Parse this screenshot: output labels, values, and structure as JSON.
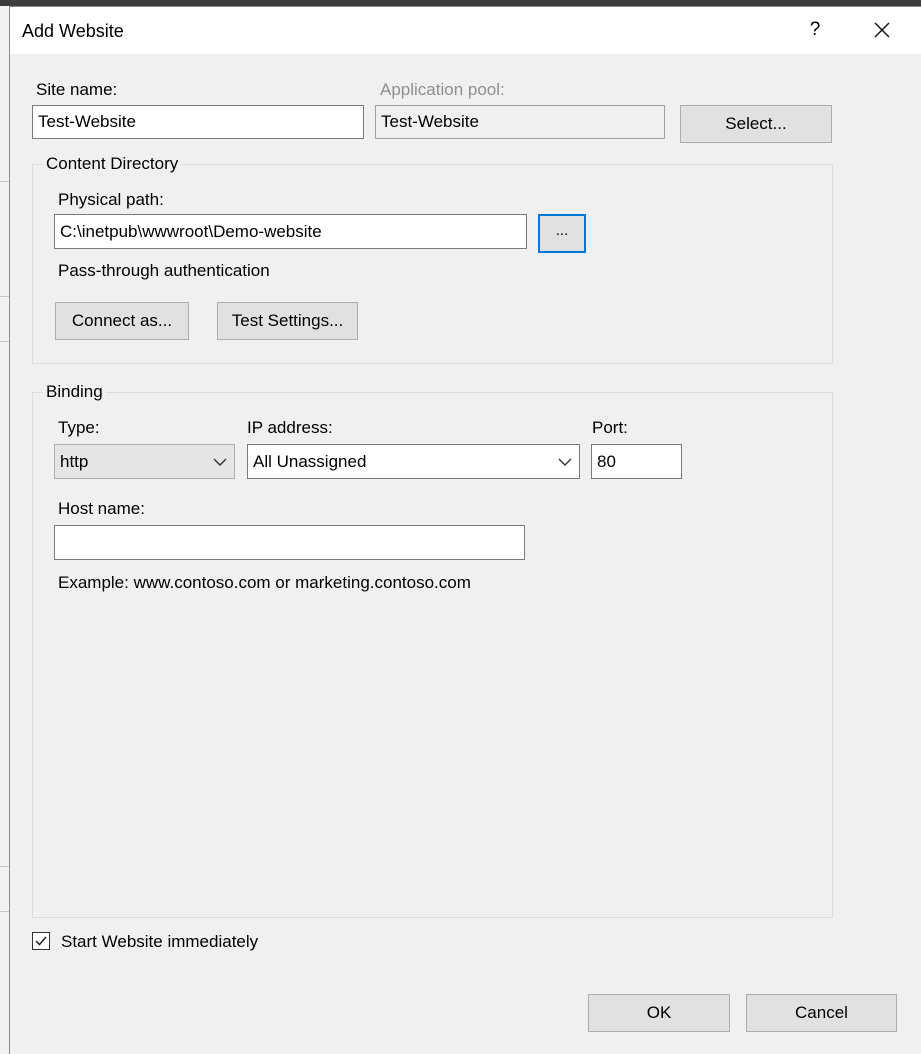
{
  "dialog": {
    "title": "Add Website",
    "help_label": "?"
  },
  "site": {
    "site_name_label": "Site name:",
    "site_name_value": "Test-Website",
    "app_pool_label": "Application pool:",
    "app_pool_value": "Test-Website",
    "select_button": "Select..."
  },
  "content_directory": {
    "legend": "Content Directory",
    "physical_path_label": "Physical path:",
    "physical_path_value": "C:\\inetpub\\wwwroot\\Demo-website",
    "browse_button": "...",
    "passthrough_label": "Pass-through authentication",
    "connect_as_button": "Connect as...",
    "test_settings_button": "Test Settings..."
  },
  "binding": {
    "legend": "Binding",
    "type_label": "Type:",
    "type_value": "http",
    "ip_label": "IP address:",
    "ip_value": "All Unassigned",
    "port_label": "Port:",
    "port_value": "80",
    "host_label": "Host name:",
    "host_value": "",
    "example_text": "Example: www.contoso.com or marketing.contoso.com"
  },
  "start_immediately": {
    "label": "Start Website immediately",
    "checked": true
  },
  "footer": {
    "ok_button": "OK",
    "cancel_button": "Cancel"
  },
  "colors": {
    "dialog_bg": "#f0f0f0",
    "focus_border": "#0078d7",
    "disabled_text": "#8f8f8f"
  },
  "icons": {
    "close": "close-icon",
    "chevron": "chevron-down-icon",
    "check": "checkmark-icon"
  }
}
